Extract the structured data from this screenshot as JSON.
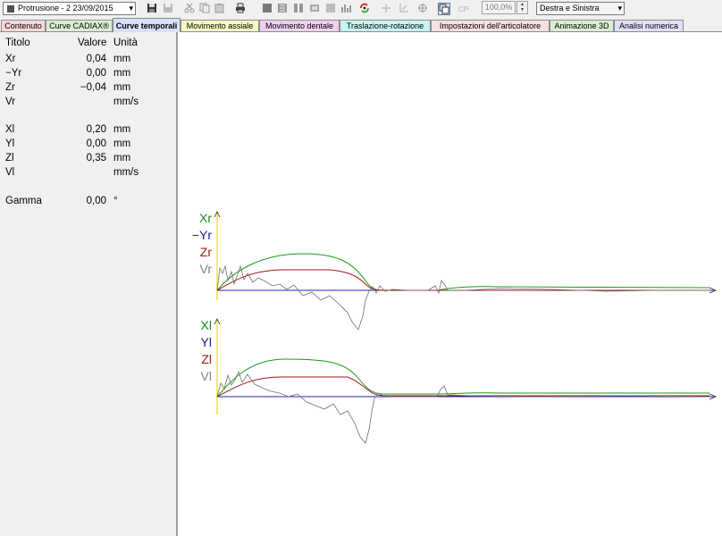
{
  "toolbar": {
    "session_select_value": "Protrusione - 2 23/09/2015",
    "zoom_value": "100,0%",
    "side_select_value": "Destra e Sinistra",
    "icons": [
      "save-icon",
      "save-as-icon",
      "cut-icon",
      "copy-icon",
      "paste-icon",
      "print-icon",
      "layout-1-icon",
      "layout-2-icon",
      "layout-3-icon",
      "layout-4-icon",
      "layout-5-icon",
      "layout-6-icon",
      "refresh-icon",
      "crosshair-icon",
      "axes-icon",
      "compass-icon",
      "copy-image-icon",
      "cpm-icon"
    ]
  },
  "tabs": [
    {
      "label": "Contenuto",
      "color": "#f8d8d8",
      "active": false
    },
    {
      "label": "Curve CADIAX®",
      "color": "#d8f0d0",
      "active": false
    },
    {
      "label": "Curve temporali",
      "color": "#d8e0f8",
      "active": true
    },
    {
      "label": "Movimento assiale",
      "color": "#f8f8c8",
      "active": false
    },
    {
      "label": "Movimento dentale",
      "color": "#f0d0f0",
      "active": false
    },
    {
      "label": "Traslazione-rotazione",
      "color": "#c8f4f4",
      "active": false
    },
    {
      "label": "Impostazioni dell'articolatore",
      "color": "#f8e0e0",
      "active": false
    },
    {
      "label": "Animazione 3D",
      "color": "#d8f0d0",
      "active": false
    },
    {
      "label": "Analisi numerica",
      "color": "#e0e0f8",
      "active": false
    }
  ],
  "table": {
    "headers": {
      "title": "Titolo",
      "value": "Valore",
      "unit": "Unità"
    },
    "rows": [
      {
        "title": "Xr",
        "value": "0,04",
        "unit": "mm"
      },
      {
        "title": "−Yr",
        "value": "0,00",
        "unit": "mm"
      },
      {
        "title": "Zr",
        "value": "−0,04",
        "unit": "mm"
      },
      {
        "title": "Vr",
        "value": "",
        "unit": "mm/s"
      },
      {
        "title": "Xl",
        "value": "0,20",
        "unit": "mm"
      },
      {
        "title": "Yl",
        "value": "0,00",
        "unit": "mm"
      },
      {
        "title": "Zl",
        "value": "0,35",
        "unit": "mm"
      },
      {
        "title": "Vl",
        "value": "",
        "unit": "mm/s"
      },
      {
        "title": "Gamma",
        "value": "0,00",
        "unit": "°"
      }
    ]
  },
  "charts": {
    "right_legend": [
      {
        "label": "Xr",
        "color": "#1a8a1a"
      },
      {
        "label": "−Yr",
        "color": "#1a1aa0"
      },
      {
        "label": "Zr",
        "color": "#a01818"
      },
      {
        "label": "Vr",
        "color": "#808080"
      }
    ],
    "left_legend": [
      {
        "label": "Xl",
        "color": "#1a8a1a"
      },
      {
        "label": "Yl",
        "color": "#1a1aa0"
      },
      {
        "label": "Zl",
        "color": "#a01818"
      },
      {
        "label": "Vl",
        "color": "#808080"
      }
    ]
  },
  "colors": {
    "axis_y": "#e8e000",
    "x_trace": "#1a9a1a",
    "y_trace": "#2020c0",
    "z_trace": "#a01818",
    "v_trace": "#707070"
  }
}
